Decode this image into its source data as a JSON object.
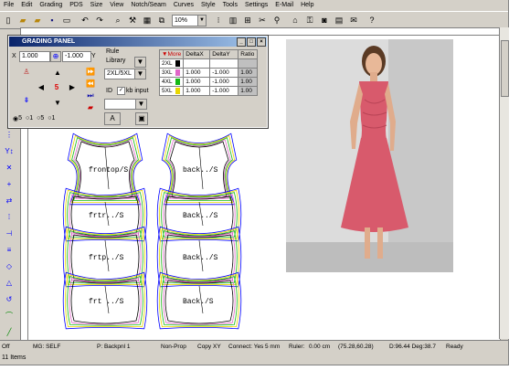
{
  "menu": [
    "File",
    "Edit",
    "Grading",
    "PDS",
    "Size",
    "View",
    "Notch/Seam",
    "Curves",
    "Style",
    "Tools",
    "Settings",
    "E-Mail",
    "Help"
  ],
  "toolbar": {
    "icons": [
      "new-file",
      "open-file",
      "open-folder",
      "save",
      "print",
      "undo",
      "redo",
      "zoom",
      "hammer",
      "grid",
      "mirror"
    ],
    "zoom_value": "10%",
    "icons2": [
      "scan",
      "measure",
      "scissor",
      "figure",
      "camera",
      "mail",
      "help"
    ]
  },
  "left_tools": [
    "select",
    "node",
    "point",
    "x-axis",
    "y-axis",
    "plus",
    "arrows",
    "dots",
    "measure",
    "layers",
    "shape",
    "triangle",
    "rotate",
    "diagonal"
  ],
  "panel": {
    "title": "GRADING PANEL",
    "x_label": "X",
    "x_value": "1.000",
    "y_value": "-1.000",
    "y_label": "Y",
    "rule_label": "Rule",
    "library_value": "Library",
    "range_value": "2XL/5XL",
    "id_label": "ID",
    "kb_input_label": "kb input",
    "center_num": "5",
    "a_button": "A",
    "radio_options": [
      "5",
      "1",
      "5",
      "1"
    ],
    "table_headers": [
      "More",
      "DeltaX",
      "DeltaY",
      "Ratio"
    ],
    "table_rows": [
      {
        "size": "2XL",
        "color": "#000000",
        "dx": "",
        "dy": "",
        "ratio": ""
      },
      {
        "size": "3XL",
        "color": "#e066c8",
        "dx": "1.000",
        "dy": "-1.000",
        "ratio": "1.00"
      },
      {
        "size": "4XL",
        "color": "#14b814",
        "dx": "1.000",
        "dy": "-1.000",
        "ratio": "1.00"
      },
      {
        "size": "5XL",
        "color": "#e8d600",
        "dx": "1.000",
        "dy": "-1.000",
        "ratio": "1.00"
      }
    ]
  },
  "patterns": [
    {
      "label": "frontop/S"
    },
    {
      "label": "back../S"
    },
    {
      "label": "frtr../S"
    },
    {
      "label": "Back../S"
    },
    {
      "label": "frtp../S"
    },
    {
      "label": "Back../S"
    },
    {
      "label": "frt ../S"
    },
    {
      "label": "Back./S"
    }
  ],
  "status": {
    "mode": "Off",
    "mg": "MG: SELF",
    "piece": "P: Backpnl 1",
    "prop": "Non-Prop",
    "copy": "Copy XY",
    "connect": "Connect: Yes",
    "connect_val": "5 mm",
    "ruler": "Ruler:",
    "ruler_val": "0.00 cm",
    "coords": "(75.28,60.28)",
    "dist": "D:96.44 Deg:38.7",
    "ready": "Ready"
  },
  "items_count": "11 Items",
  "colors": {
    "accent": "#0a246a",
    "dress": "#d85a6c",
    "grade_pink": "#e066c8",
    "grade_green": "#14b814",
    "grade_yellow": "#e8d600",
    "grade_blue": "#0000ff"
  }
}
